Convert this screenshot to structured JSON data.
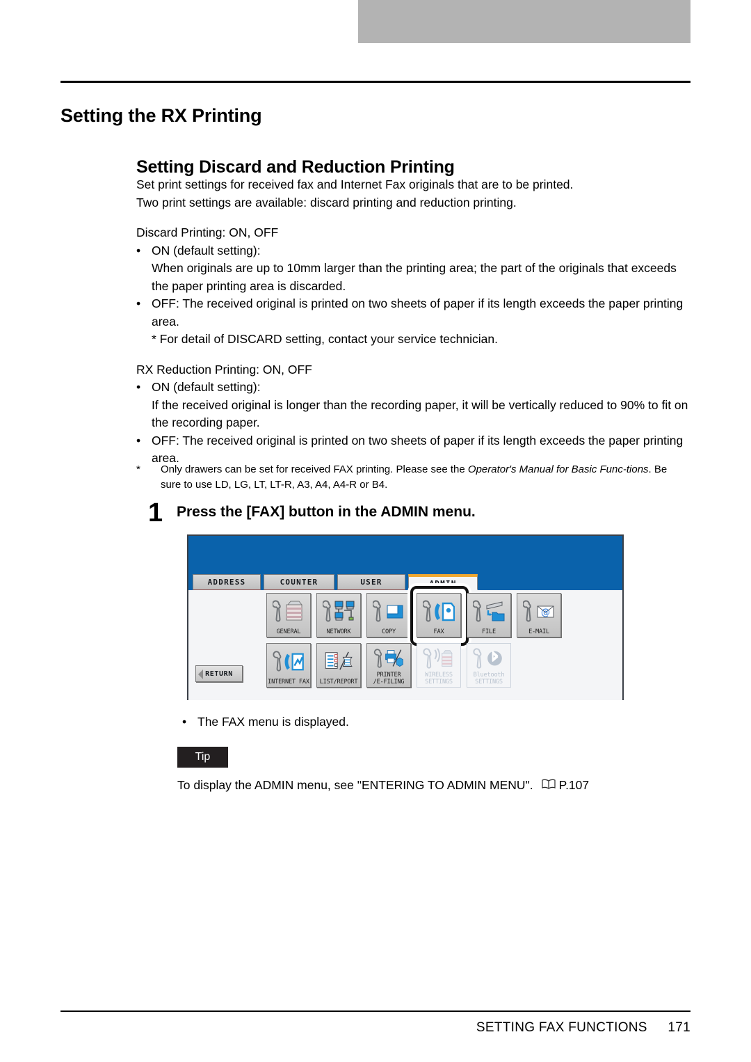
{
  "document": {
    "chapter_title": "Setting the RX Printing",
    "section_title": "Setting Discard and Reduction Printing",
    "intro_line_1": "Set print settings for received fax and Internet Fax originals that are to be printed.",
    "intro_line_2": "Two print settings are available: discard printing and reduction printing.",
    "discard": {
      "heading": "Discard Printing: ON, OFF",
      "on_label": "ON (default setting):",
      "on_body": "When originals are up to 10mm larger than the printing area; the part of the originals that exceeds the paper printing area is discarded.",
      "off_body": "OFF: The received original is printed on two sheets of paper if its length exceeds the paper printing area.",
      "note": "* For detail of DISCARD setting, contact your service technician."
    },
    "reduction": {
      "heading": "RX Reduction Printing: ON, OFF",
      "on_label": "ON (default setting):",
      "on_body": "If the received original is longer than the recording paper, it will be vertically reduced to 90% to fit on the recording paper.",
      "off_body": "OFF: The received original is printed on two sheets of paper if its length exceeds the paper printing area."
    },
    "footnote": {
      "mark": "*",
      "part1": "Only drawers can be set for received FAX printing.   Please see the ",
      "italic1": "Operator's Manual for Basic Func-",
      "italic2": "tions",
      "part2": ". Be sure to use LD, LG, LT, LT-R, A3, A4, A4-R or B4."
    },
    "step": {
      "number": "1",
      "title": "Press the [FAX] button in the ADMIN menu."
    },
    "result_bullet": "•",
    "result_text": "The FAX menu is displayed.",
    "tip": {
      "badge": "Tip",
      "text_before": "To display the ADMIN menu, see \"ENTERING TO ADMIN MENU\".",
      "reference": "P.107",
      "book_icon": "book-icon"
    },
    "footer": {
      "title": "SETTING FAX FUNCTIONS",
      "page": "171"
    },
    "bullet_char": "•"
  },
  "lcd_panel": {
    "header_color": "#0a62ab",
    "body_color": "#f4f5f7",
    "active_tab_accent": "#f0a830",
    "tabs": [
      {
        "label": "ADDRESS",
        "active": false
      },
      {
        "label": "COUNTER",
        "active": false
      },
      {
        "label": "USER",
        "active": false
      },
      {
        "label": "ADMIN",
        "active": true
      }
    ],
    "buttons_row1": [
      {
        "label": "GENERAL",
        "icon": "wrench-copier-icon",
        "disabled": false,
        "highlighted": false
      },
      {
        "label": "NETWORK",
        "icon": "wrench-network-icon",
        "disabled": false,
        "highlighted": false
      },
      {
        "label": "COPY",
        "icon": "wrench-copy-icon",
        "disabled": false,
        "highlighted": false
      },
      {
        "label": "FAX",
        "icon": "wrench-fax-icon",
        "disabled": false,
        "highlighted": true
      },
      {
        "label": "FILE",
        "icon": "wrench-file-icon",
        "disabled": false,
        "highlighted": false
      },
      {
        "label": "E-MAIL",
        "icon": "wrench-email-icon",
        "disabled": false,
        "highlighted": false
      }
    ],
    "buttons_row2": [
      {
        "label": "INTERNET FAX",
        "icon": "wrench-internetfax-icon",
        "disabled": false
      },
      {
        "label": "LIST/REPORT",
        "icon": "list-report-icon",
        "disabled": false
      },
      {
        "label": "PRINTER\n/E-FILING",
        "icon": "wrench-printer-icon",
        "disabled": false
      },
      {
        "label": "WIRELESS\nSETTINGS",
        "icon": "wireless-icon",
        "disabled": true
      },
      {
        "label": "Bluetooth\nSETTINGS",
        "icon": "bluetooth-icon",
        "disabled": true
      }
    ],
    "return_button": "RETURN"
  }
}
